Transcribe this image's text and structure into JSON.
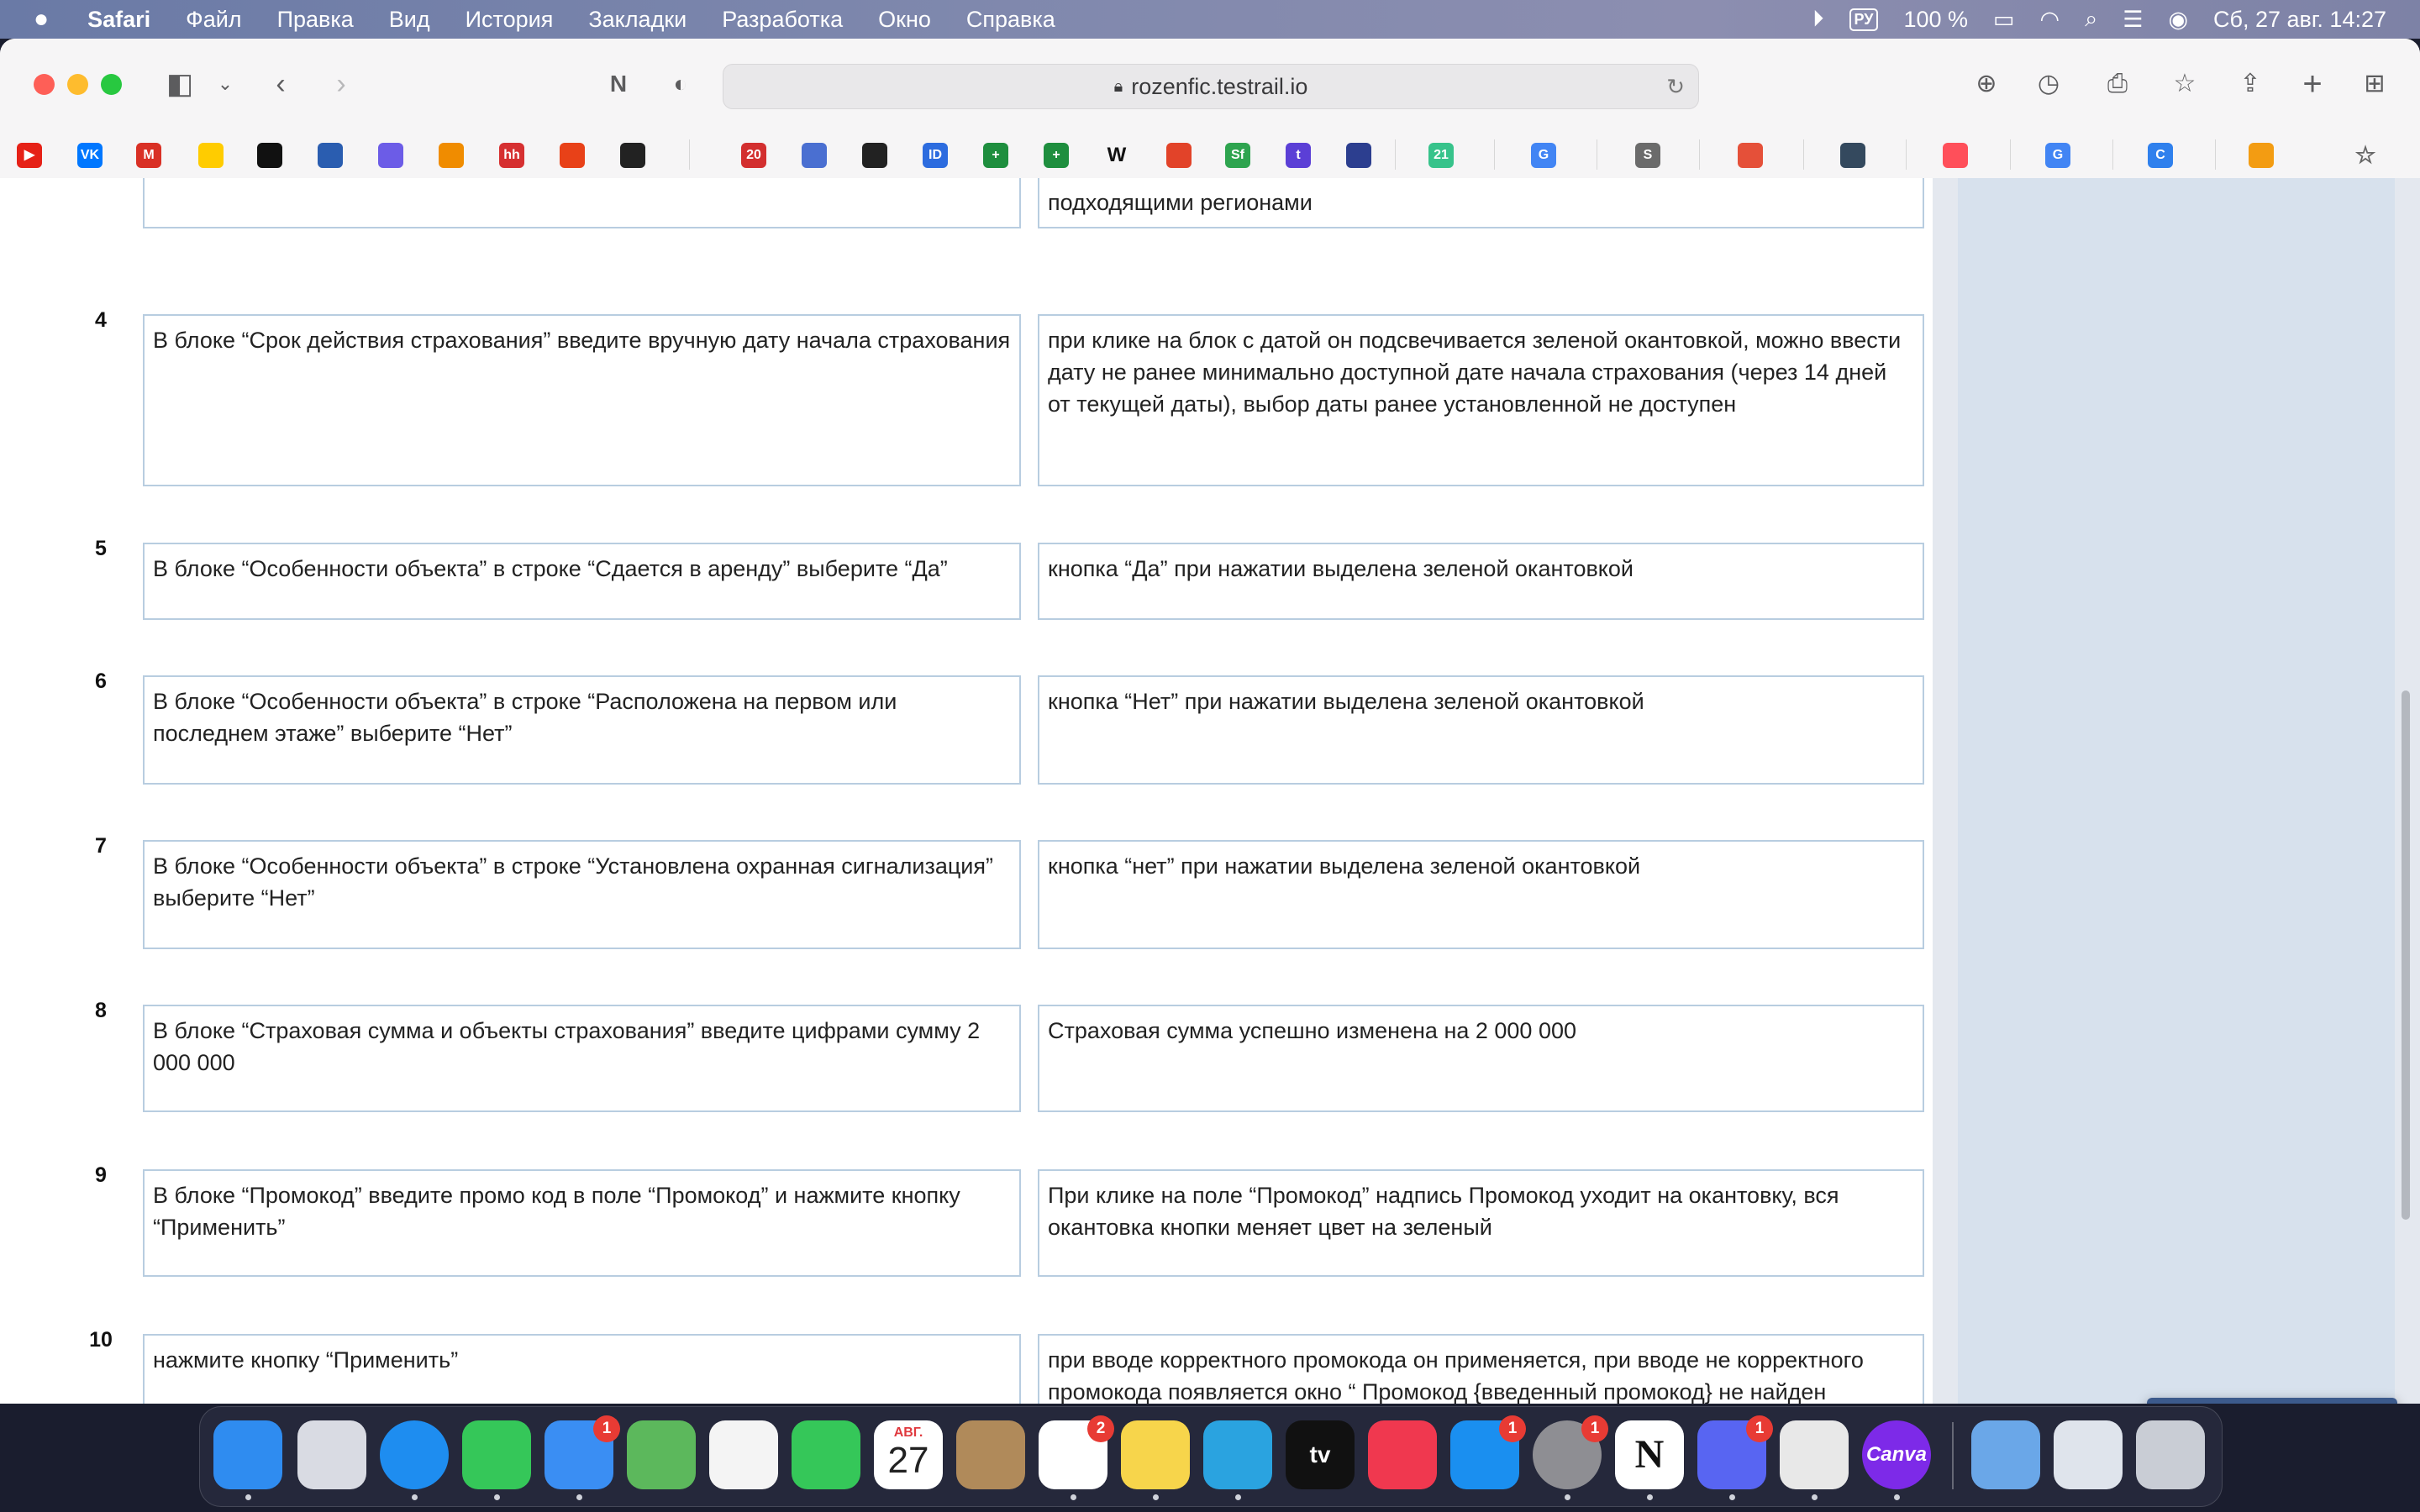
{
  "menubar": {
    "app": "Safari",
    "items": [
      "Файл",
      "Правка",
      "Вид",
      "История",
      "Закладки",
      "Разработка",
      "Окно",
      "Справка"
    ],
    "lang": "РУ",
    "battery": "100 %",
    "datetime": "Сб, 27 авг.  14:27"
  },
  "browser": {
    "url": "rozenfic.testrail.io"
  },
  "bookmarks": [
    "youtube",
    "vk",
    "gmail",
    "yandex",
    "dark",
    "rocket",
    "dots",
    "monkey",
    "hh",
    "send",
    "pill",
    "2035",
    "flag",
    "bug",
    "id",
    "sheets-1",
    "sheets-2",
    "wiki",
    "gitlab",
    "sf",
    "t",
    "grid",
    "21",
    "google-1",
    "s",
    "arrow",
    "book",
    "loop",
    "google-2",
    "c",
    "flower"
  ],
  "steps": [
    {
      "num": "",
      "action": "",
      "expected": "подходящими регионами"
    },
    {
      "num": "4",
      "action": "В блоке “Срок действия страхования” введите вручную дату начала страхования",
      "expected": "при клике на блок с датой он подсвечивается зеленой окантовкой, можно ввести дату не ранее минимально доступной дате начала страхования (через 14 дней от текущей даты), выбор даты ранее установленной не доступен"
    },
    {
      "num": "5",
      "action": "В блоке “Особенности объекта” в строке “Сдается в аренду” выберите “Да”",
      "expected": "кнопка “Да” при нажатии выделена зеленой окантовкой"
    },
    {
      "num": "6",
      "action": "В блоке “Особенности объекта” в строке “Расположена на первом или последнем этаже” выберите “Нет”",
      "expected": "кнопка “Нет” при нажатии выделена зеленой окантовкой"
    },
    {
      "num": "7",
      "action": "В блоке “Особенности объекта” в строке “Установлена охранная сигнализация” выберите “Нет”",
      "expected": "кнопка “нет” при нажатии выделена зеленой окантовкой"
    },
    {
      "num": "8",
      "action": "В блоке “Страховая сумма и объекты страхования” введите цифрами сумму 2 000 000",
      "expected": "Страховая сумма успешно изменена на 2 000 000"
    },
    {
      "num": "9",
      "action": "В блоке “Промокод” введите промо код в поле “Промокод” и нажмите кнопку “Применить”",
      "expected": "При клике на поле “Промокод” надпись Промокод уходит на окантовку, вся окантовка кнопки меняет цвет на зеленый"
    },
    {
      "num": "10",
      "action": "нажмите кнопку “Применить”",
      "expected": "при вводе корректного промокода он применяется, при вводе не корректного промокода появляется окно “ Промокод {введенный промокод} не найден"
    }
  ],
  "dock": {
    "calendar_month": "АВГ.",
    "calendar_day": "27",
    "apps": [
      {
        "name": "finder",
        "color": "#2f8cf0",
        "badge": ""
      },
      {
        "name": "launchpad",
        "color": "#d9dbe3",
        "badge": ""
      },
      {
        "name": "safari",
        "color": "#1e8df0",
        "badge": ""
      },
      {
        "name": "messages",
        "color": "#35c759",
        "badge": ""
      },
      {
        "name": "mail",
        "color": "#3a8ef3",
        "badge": "1"
      },
      {
        "name": "maps",
        "color": "#5cb85c",
        "badge": ""
      },
      {
        "name": "photos",
        "color": "#f4f4f4",
        "badge": ""
      },
      {
        "name": "facetime",
        "color": "#35c759",
        "badge": ""
      },
      {
        "name": "calendar",
        "color": "#ffffff",
        "badge": ""
      },
      {
        "name": "contacts",
        "color": "#b08a5a",
        "badge": ""
      },
      {
        "name": "reminders",
        "color": "#ffffff",
        "badge": "2"
      },
      {
        "name": "notes",
        "color": "#f7d54b",
        "badge": ""
      },
      {
        "name": "telegram",
        "color": "#2aa3e0",
        "badge": ""
      },
      {
        "name": "tv",
        "color": "#111111",
        "badge": ""
      },
      {
        "name": "music",
        "color": "#f0384f",
        "badge": ""
      },
      {
        "name": "app-store",
        "color": "#1a8ff0",
        "badge": "1"
      },
      {
        "name": "system-settings",
        "color": "#8e8e93",
        "badge": "1"
      },
      {
        "name": "notion",
        "color": "#ffffff",
        "badge": ""
      },
      {
        "name": "discord",
        "color": "#5865f2",
        "badge": "1"
      },
      {
        "name": "vpn",
        "color": "#e8e8e8",
        "badge": ""
      },
      {
        "name": "canva",
        "color": "#7d2ae8",
        "badge": ""
      },
      {
        "name": "downloads",
        "color": "#6aa7e8",
        "badge": ""
      },
      {
        "name": "screenshot",
        "color": "#dfe4ec",
        "badge": ""
      },
      {
        "name": "trash",
        "color": "#c9cdd5",
        "badge": ""
      }
    ],
    "tv_label": "tv",
    "canva_label": "Canva",
    "notion_label": "N"
  }
}
